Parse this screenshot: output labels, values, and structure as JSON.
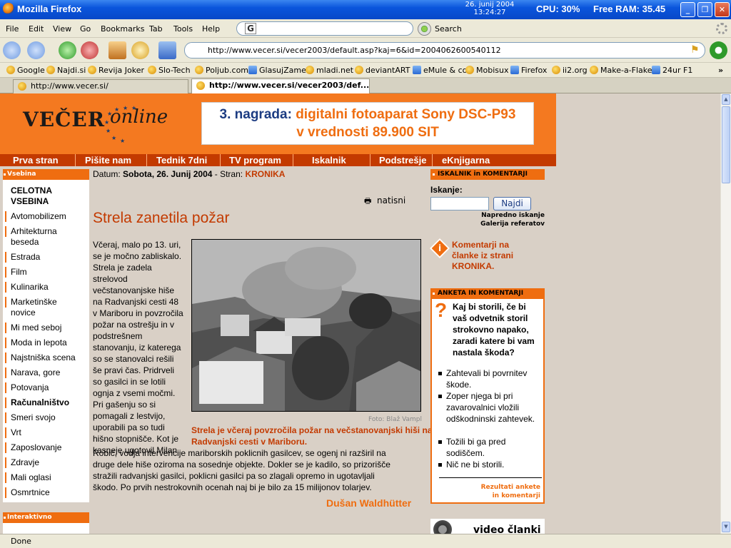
{
  "window": {
    "title": "Mozilla Firefox",
    "date": "26. junij 2004",
    "time": "13:24:27",
    "cpu": "CPU: 30%",
    "ram": "Free RAM: 35.45"
  },
  "menu": [
    "File",
    "Edit",
    "View",
    "Go",
    "Bookmarks",
    "Tab",
    "Tools",
    "Help"
  ],
  "search": {
    "engine_letter": "G",
    "button": "Search"
  },
  "url": "http://www.vecer.si/vecer2003/default.asp?kaj=6&id=2004062600540112",
  "bookmarks": [
    "Google",
    "Najdi.si",
    "Revija Joker",
    "Slo-Tech",
    "Poljub.com",
    "GlasujZame",
    "mladi.net",
    "deviantART",
    "eMule & co",
    "Mobisux",
    "Firefox",
    "ii2.org",
    "Make-a-Flake",
    "24ur F1"
  ],
  "bookmarks_more": "»",
  "tabs": [
    "http://www.vecer.si/",
    "http://www.vecer.si/vecer2003/def..."
  ],
  "site": {
    "logo_main": "VEČER",
    "logo_online": "online",
    "banner_line1_a": "3. nagrada:",
    "banner_line1_b": "digitalni fotoaparat Sony DSC-P93",
    "banner_line2": "v vrednosti 89.900 SIT",
    "topnav": [
      "Prva stran",
      "Pišite nam",
      "Tednik 7dni",
      "TV program",
      "Iskalnik",
      "Podstrešje",
      "eKnjigarna"
    ]
  },
  "left": {
    "head": "Vsebina",
    "first": "CELOTNA VSEBINA",
    "items": [
      "Avtomobilizem",
      "Arhitekturna beseda",
      "Estrada",
      "Film",
      "Kulinarika",
      "Marketinške novice",
      "Mi med seboj",
      "Moda in lepota",
      "Najstniška scena",
      "Narava, gore",
      "Potovanja",
      "Računalništvo",
      "Smeri svojo",
      "Vrt",
      "Zaposlovanje",
      "Zdravje",
      "Mali oglasi",
      "Osmrtnice"
    ],
    "head2": "Interaktivno"
  },
  "article": {
    "datum_label": "Datum:",
    "datum": "Sobota, 26. Junij 2004",
    "stran_label": "- Stran:",
    "stran": "KRONIKA",
    "print": "natisni",
    "title": "Strela zanetila požar",
    "col_lines": [
      "Včeraj, malo po 13. uri,",
      "se je močno zabliskalo.",
      "Strela je zadela",
      "strelovod",
      "večstanovanjske hiše",
      "na Radvanjski cesti 48",
      "v Mariboru in povzročila",
      "požar na ostrešju in v",
      "podstrešnem",
      "stanovanju, iz katerega",
      "so se stanovalci rešili",
      "še pravi čas. Pridrveli",
      "so gasilci in se lotili",
      "ognja z vsemi močmi.",
      "Pri gašenju so si",
      "pomagali z lestvijo,",
      "uporabili pa so tudi",
      "hišno stopnišče. Kot je",
      "kasneje ugotovil Milan"
    ],
    "full_lines": [
      "Robič, vodja intervencije mariborskih poklicnih gasilcev, se ogenj ni razširil na",
      "druge dele hiše oziroma na sosednje objekte. Dokler se je kadilo, so prizorišče",
      "stražili radvanjski gasilci, poklicni gasilci pa so zlagali opremo in ugotavljali",
      "škodo. Po prvih nestrokovnih ocenah naj bi je bilo za 15 milijonov tolarjev."
    ],
    "photo_credit": "Foto: Blaž Vampl",
    "caption": "Strela je včeraj povzročila požar na večstanovanjski hiši na Radvanjski cesti v Mariboru.",
    "author": "Dušan Waldhütter"
  },
  "right": {
    "head1": "ISKALNIK in KOMENTARJI",
    "iskanje": "Iskanje:",
    "najdi": "Najdi",
    "napredno": "Napredno iskanje",
    "galerija": "Galerija referatov",
    "komentarji": "Komentarji na članke iz strani KRONIKA.",
    "head2": "ANKETA IN KOMENTARJI",
    "question": "Kaj bi storili, če bi vaš odvetnik storil strokovno napako, zaradi katere bi vam nastala škoda?",
    "options": [
      "Zahtevali bi povrnitev škode.",
      "Zoper njega bi pri zavarovalnici vložili odškodninski zahtevek.",
      "Tožili bi ga pred sodiščem.",
      "Nič ne bi storili."
    ],
    "rezultati": "Rezultati ankete in komentarji",
    "video": "video članki"
  },
  "status": "Done"
}
